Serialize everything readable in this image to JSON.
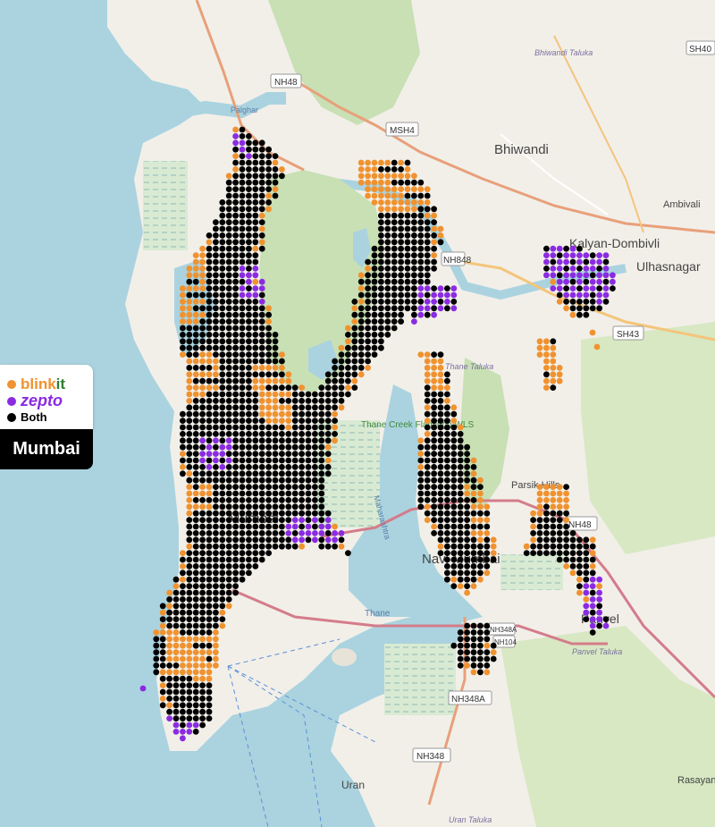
{
  "city": "Mumbai",
  "legend": [
    {
      "label_main": "blink",
      "label_accent": "it",
      "color": "#f0922f",
      "accent_color": "#2f7d32"
    },
    {
      "label_main": "zepto",
      "color": "#8a2be2"
    },
    {
      "label_main": "Both",
      "color": "#000000"
    }
  ],
  "colors": {
    "blinkit": "#f0922f",
    "zepto": "#8a2be2",
    "both": "#000000",
    "sea": "#aad3df",
    "land": "#f2efe9",
    "park": "#c8e0b4"
  },
  "map_labels": {
    "bhiwandi": "Bhiwandi",
    "bhiwandi_taluka": "Bhiwandi Taluka",
    "kalyan": "Kalyan-Dombivli",
    "ulhasnagar": "Ulhasnagar",
    "ambivali": "Ambivali",
    "thane_taluka": "Thane Taluka",
    "thane_creek": "Thane Creek Flamingo WLS",
    "parsik": "Parsik Hills",
    "navi_mumbai": "Navi Mumbai",
    "mumbai": "Mumbai",
    "panvel": "Panvel",
    "panvel_taluka": "Panvel Taluka",
    "thane": "Thane",
    "uran": "Uran",
    "uran_taluka": "Uran Taluka",
    "rasayani": "Rasayan",
    "palghar": "Palghar",
    "maharashtra": "Maharashtra"
  },
  "road_shields": {
    "nh48_top": "NH48",
    "msh4": "MSH4",
    "sh40": "SH40",
    "nh848": "NH848",
    "sh43": "SH43",
    "nh48_right": "NH48",
    "nh348a": "NH348A",
    "nh348": "NH348",
    "nh348a_top": "NH348A",
    "nh104": "NH104"
  }
}
